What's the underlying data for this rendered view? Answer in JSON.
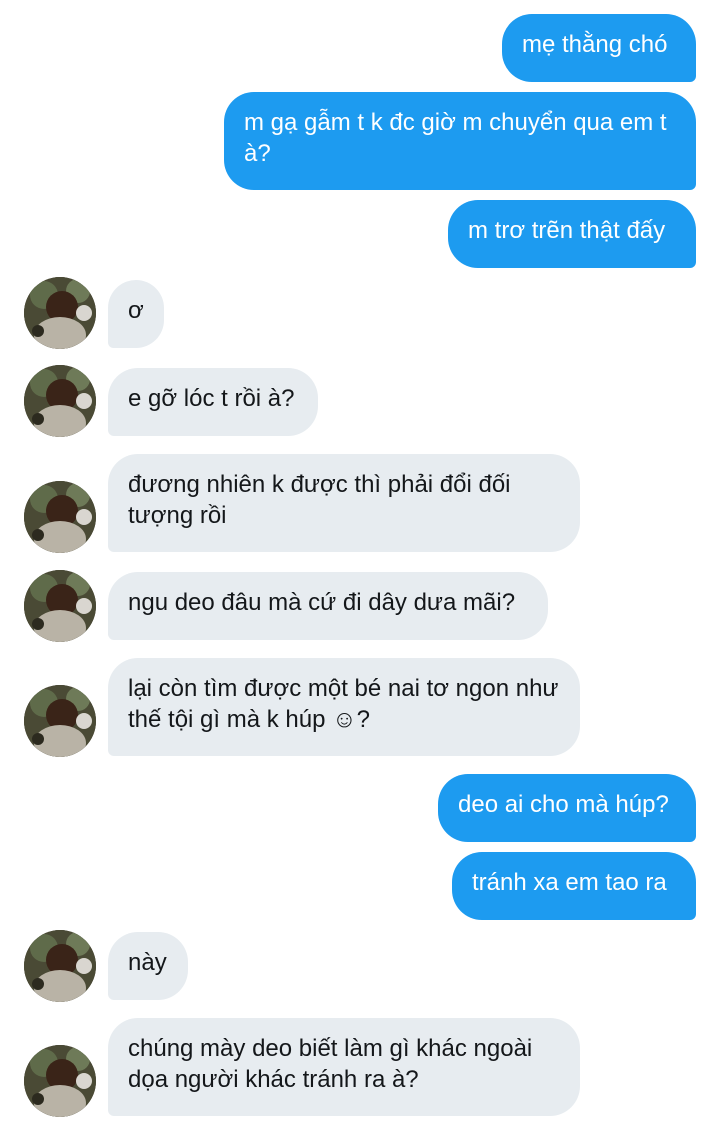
{
  "messages": [
    {
      "side": "out",
      "text": "mẹ thằng chó"
    },
    {
      "side": "out",
      "text": "m gạ gẫm t k đc giờ m chuyển qua em t à?"
    },
    {
      "side": "out",
      "text": "m trơ trẽn thật đấy"
    },
    {
      "side": "in",
      "text": "ơ"
    },
    {
      "side": "in",
      "text": "e gỡ lóc t rồi à?"
    },
    {
      "side": "in",
      "text": "đương nhiên k được thì phải đổi đối tượng rồi"
    },
    {
      "side": "in",
      "text": "ngu deo đâu mà cứ đi dây dưa mãi?"
    },
    {
      "side": "in",
      "text": "lại còn tìm được một bé nai tơ ngon như thế tội gì mà k húp ☺?"
    },
    {
      "side": "out",
      "text": "deo ai cho mà húp?"
    },
    {
      "side": "out",
      "text": "tránh xa em tao ra"
    },
    {
      "side": "in",
      "text": "này"
    },
    {
      "side": "in",
      "text": "chúng mày deo biết làm gì khác ngoài dọa người khác tránh ra à?"
    }
  ],
  "colors": {
    "outgoing_bubble": "#1d9bf0",
    "incoming_bubble": "#e7ecf0"
  },
  "icons": {
    "avatar": "profile-photo-avatar"
  }
}
